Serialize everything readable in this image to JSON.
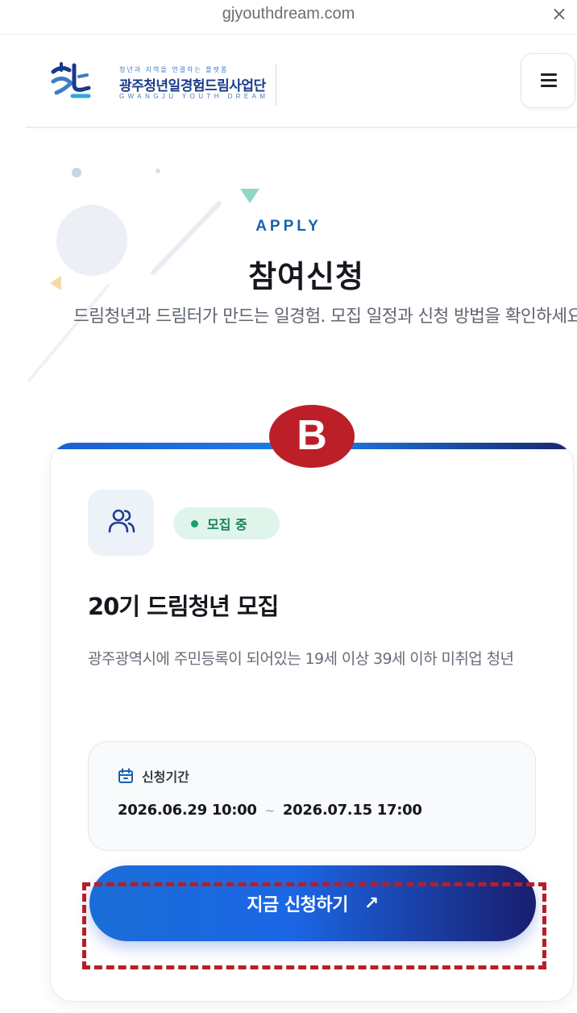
{
  "browser": {
    "url": "gjyouthdream.com",
    "close_glyph": "×"
  },
  "header": {
    "logo": {
      "tagline": "청년과 지역을 연결하는 플랫폼",
      "title": "광주청년일경험드림사업단",
      "subtitle": "GWANGJU YOUTH DREAM"
    },
    "menu_icon": "hamburger-menu-icon"
  },
  "hero": {
    "eyebrow": "APPLY",
    "title": "참여신청",
    "description": "드림청년과 드림터가 만드는 일경험. 모집 일정과 신청 방법을 확인하세요."
  },
  "step_badge": "B",
  "card": {
    "icon": "users-icon",
    "status": "모집 중",
    "title": "20기 드림청년 모집",
    "description": "광주광역시에 주민등록이 되어있는 19세 이상 39세 이하 미취업 청년",
    "period": {
      "icon": "calendar-icon",
      "label": "신청기간",
      "start": "2026.06.29 10:00",
      "separator": "~",
      "end": "2026.07.15 17:00"
    },
    "cta": {
      "label": "지금 신청하기",
      "arrow": "↗"
    }
  },
  "colors": {
    "accent": "#1761b0",
    "badge": "#bc1f27",
    "status": "#17a06b",
    "cta_start": "#1a6dd6",
    "cta_end": "#1a1e6e"
  }
}
